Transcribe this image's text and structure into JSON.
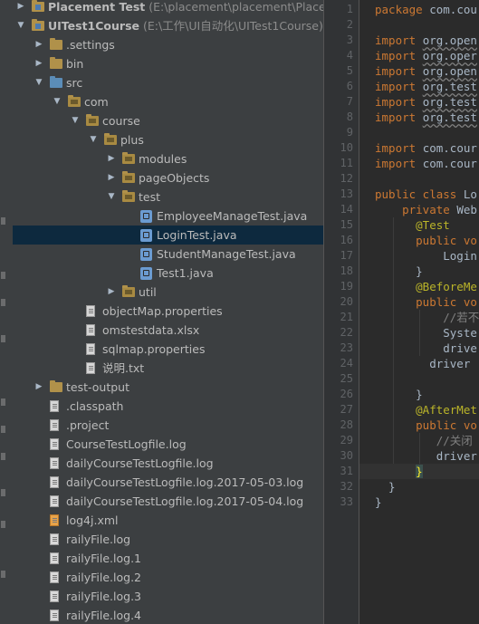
{
  "project_tree": {
    "rows": [
      {
        "label": "Placement Test",
        "path": " (E:\\placement\\placement\\Placement",
        "bold": true,
        "indent": 0,
        "arrow": "right",
        "icon": "project-folder-icon",
        "iconClass": "folder proj"
      },
      {
        "label": "UITest1Course",
        "path": " (E:\\工作\\UI自动化\\UITest1Course)",
        "bold": true,
        "indent": 0,
        "arrow": "down",
        "icon": "project-folder-icon",
        "iconClass": "folder proj"
      },
      {
        "label": ".settings",
        "indent": 1,
        "arrow": "right",
        "icon": "folder-icon",
        "iconClass": "folder"
      },
      {
        "label": "bin",
        "indent": 1,
        "arrow": "right",
        "icon": "folder-icon",
        "iconClass": "folder"
      },
      {
        "label": "src",
        "indent": 1,
        "arrow": "down",
        "icon": "source-folder-icon",
        "iconClass": "folder src"
      },
      {
        "label": "com",
        "indent": 2,
        "arrow": "down",
        "icon": "package-icon",
        "iconClass": "folder pkg"
      },
      {
        "label": "course",
        "indent": 3,
        "arrow": "down",
        "icon": "package-icon",
        "iconClass": "folder pkg"
      },
      {
        "label": "plus",
        "indent": 4,
        "arrow": "down",
        "icon": "package-icon",
        "iconClass": "folder pkg"
      },
      {
        "label": "modules",
        "indent": 5,
        "arrow": "right",
        "icon": "package-icon",
        "iconClass": "folder pkg"
      },
      {
        "label": "pageObjects",
        "indent": 5,
        "arrow": "right",
        "icon": "package-icon",
        "iconClass": "folder pkg"
      },
      {
        "label": "test",
        "indent": 5,
        "arrow": "down",
        "icon": "package-icon",
        "iconClass": "folder pkg"
      },
      {
        "label": "EmployeeManageTest.java",
        "indent": 6,
        "arrow": "",
        "icon": "java-file-icon",
        "iconClass": "java"
      },
      {
        "label": "LoginTest.java",
        "indent": 6,
        "arrow": "",
        "icon": "java-file-icon",
        "iconClass": "java",
        "selected": true
      },
      {
        "label": "StudentManageTest.java",
        "indent": 6,
        "arrow": "",
        "icon": "java-file-icon",
        "iconClass": "java"
      },
      {
        "label": "Test1.java",
        "indent": 6,
        "arrow": "",
        "icon": "java-file-icon",
        "iconClass": "java"
      },
      {
        "label": "util",
        "indent": 5,
        "arrow": "right",
        "icon": "package-icon",
        "iconClass": "folder pkg"
      },
      {
        "label": "objectMap.properties",
        "indent": 3,
        "arrow": "",
        "icon": "properties-file-icon",
        "iconClass": "file"
      },
      {
        "label": "omstestdata.xlsx",
        "indent": 3,
        "arrow": "",
        "icon": "file-icon",
        "iconClass": "file"
      },
      {
        "label": "sqlmap.properties",
        "indent": 3,
        "arrow": "",
        "icon": "properties-file-icon",
        "iconClass": "file"
      },
      {
        "label": "说明.txt",
        "indent": 3,
        "arrow": "",
        "icon": "text-file-icon",
        "iconClass": "file"
      },
      {
        "label": "test-output",
        "indent": 1,
        "arrow": "right",
        "icon": "folder-icon",
        "iconClass": "folder"
      },
      {
        "label": ".classpath",
        "indent": 1,
        "arrow": "",
        "icon": "file-icon",
        "iconClass": "file"
      },
      {
        "label": ".project",
        "indent": 1,
        "arrow": "",
        "icon": "file-icon",
        "iconClass": "file"
      },
      {
        "label": "CourseTestLogfile.log",
        "indent": 1,
        "arrow": "",
        "icon": "log-file-icon",
        "iconClass": "file log"
      },
      {
        "label": "dailyCourseTestLogfile.log",
        "indent": 1,
        "arrow": "",
        "icon": "log-file-icon",
        "iconClass": "file log"
      },
      {
        "label": "dailyCourseTestLogfile.log.2017-05-03.log",
        "indent": 1,
        "arrow": "",
        "icon": "log-file-icon",
        "iconClass": "file log"
      },
      {
        "label": "dailyCourseTestLogfile.log.2017-05-04.log",
        "indent": 1,
        "arrow": "",
        "icon": "log-file-icon",
        "iconClass": "file log"
      },
      {
        "label": "log4j.xml",
        "indent": 1,
        "arrow": "",
        "icon": "xml-file-icon",
        "iconClass": "file xml"
      },
      {
        "label": "railyFile.log",
        "indent": 1,
        "arrow": "",
        "icon": "log-file-icon",
        "iconClass": "file log"
      },
      {
        "label": "railyFile.log.1",
        "indent": 1,
        "arrow": "",
        "icon": "log-file-icon",
        "iconClass": "file log"
      },
      {
        "label": "railyFile.log.2",
        "indent": 1,
        "arrow": "",
        "icon": "log-file-icon",
        "iconClass": "file log"
      },
      {
        "label": "railyFile.log.3",
        "indent": 1,
        "arrow": "",
        "icon": "log-file-icon",
        "iconClass": "file log"
      },
      {
        "label": "railyFile.log.4",
        "indent": 1,
        "arrow": "",
        "icon": "log-file-icon",
        "iconClass": "file log"
      }
    ]
  },
  "editor": {
    "current_line": 31,
    "lines": [
      {
        "n": "1",
        "segs": [
          {
            "t": "package com.cou",
            "c": "kwmix"
          }
        ]
      },
      {
        "n": "2",
        "segs": []
      },
      {
        "n": "3",
        "segs": [
          {
            "t": "import ",
            "c": "kw"
          },
          {
            "t": "org.open",
            "c": "imp"
          }
        ]
      },
      {
        "n": "4",
        "segs": [
          {
            "t": "import ",
            "c": "kw"
          },
          {
            "t": "org.oper",
            "c": "imp"
          }
        ]
      },
      {
        "n": "5",
        "segs": [
          {
            "t": "import ",
            "c": "kw"
          },
          {
            "t": "org.open",
            "c": "imp"
          }
        ]
      },
      {
        "n": "6",
        "segs": [
          {
            "t": "import ",
            "c": "kw"
          },
          {
            "t": "org.test",
            "c": "imp"
          }
        ]
      },
      {
        "n": "7",
        "segs": [
          {
            "t": "import ",
            "c": "kw"
          },
          {
            "t": "org.test",
            "c": "imp"
          }
        ]
      },
      {
        "n": "8",
        "segs": [
          {
            "t": "import ",
            "c": "kw"
          },
          {
            "t": "org.test",
            "c": "imp"
          }
        ]
      },
      {
        "n": "9",
        "segs": []
      },
      {
        "n": "10",
        "segs": [
          {
            "t": "import ",
            "c": "kw"
          },
          {
            "t": "com.cour",
            "c": ""
          }
        ]
      },
      {
        "n": "11",
        "segs": [
          {
            "t": "import ",
            "c": "kw"
          },
          {
            "t": "com.cour",
            "c": ""
          }
        ]
      },
      {
        "n": "12",
        "segs": []
      },
      {
        "n": "13",
        "segs": [
          {
            "t": "public class ",
            "c": "kw"
          },
          {
            "t": "Lo",
            "c": ""
          }
        ]
      },
      {
        "n": "14",
        "segs": [
          {
            "t": "    private ",
            "c": "kw"
          },
          {
            "t": "Web",
            "c": ""
          }
        ]
      },
      {
        "n": "15",
        "segs": [
          {
            "t": "      @Test",
            "c": "an"
          }
        ]
      },
      {
        "n": "16",
        "segs": [
          {
            "t": "      public ",
            "c": "kw"
          },
          {
            "t": "vo",
            "c": "kw"
          }
        ]
      },
      {
        "n": "17",
        "segs": [
          {
            "t": "          Login",
            "c": ""
          }
        ]
      },
      {
        "n": "18",
        "segs": [
          {
            "t": "      }",
            "c": ""
          }
        ]
      },
      {
        "n": "19",
        "segs": [
          {
            "t": "      @BeforeMe",
            "c": "an"
          }
        ]
      },
      {
        "n": "20",
        "segs": [
          {
            "t": "      public ",
            "c": "kw"
          },
          {
            "t": "vo",
            "c": "kw"
          }
        ]
      },
      {
        "n": "21",
        "segs": [
          {
            "t": "          //若不",
            "c": "cm"
          }
        ]
      },
      {
        "n": "22",
        "segs": [
          {
            "t": "          Syste",
            "c": ""
          }
        ]
      },
      {
        "n": "23",
        "segs": [
          {
            "t": "          drive",
            "c": ""
          }
        ]
      },
      {
        "n": "24",
        "segs": [
          {
            "t": "        driver",
            "c": ""
          }
        ]
      },
      {
        "n": "25",
        "segs": []
      },
      {
        "n": "26",
        "segs": [
          {
            "t": "      }",
            "c": ""
          }
        ]
      },
      {
        "n": "27",
        "segs": [
          {
            "t": "      @AfterMet",
            "c": "an"
          }
        ]
      },
      {
        "n": "28",
        "segs": [
          {
            "t": "      public ",
            "c": "kw"
          },
          {
            "t": "vo",
            "c": "kw"
          }
        ]
      },
      {
        "n": "29",
        "segs": [
          {
            "t": "         //关闭",
            "c": "cm"
          }
        ]
      },
      {
        "n": "30",
        "segs": [
          {
            "t": "         driver",
            "c": ""
          }
        ]
      },
      {
        "n": "31",
        "segs": [
          {
            "t": "      ",
            "c": ""
          },
          {
            "t": "}",
            "c": "brace"
          }
        ]
      },
      {
        "n": "32",
        "segs": [
          {
            "t": "  }",
            "c": ""
          }
        ]
      },
      {
        "n": "33",
        "segs": [
          {
            "t": "}",
            "c": ""
          }
        ]
      }
    ]
  }
}
